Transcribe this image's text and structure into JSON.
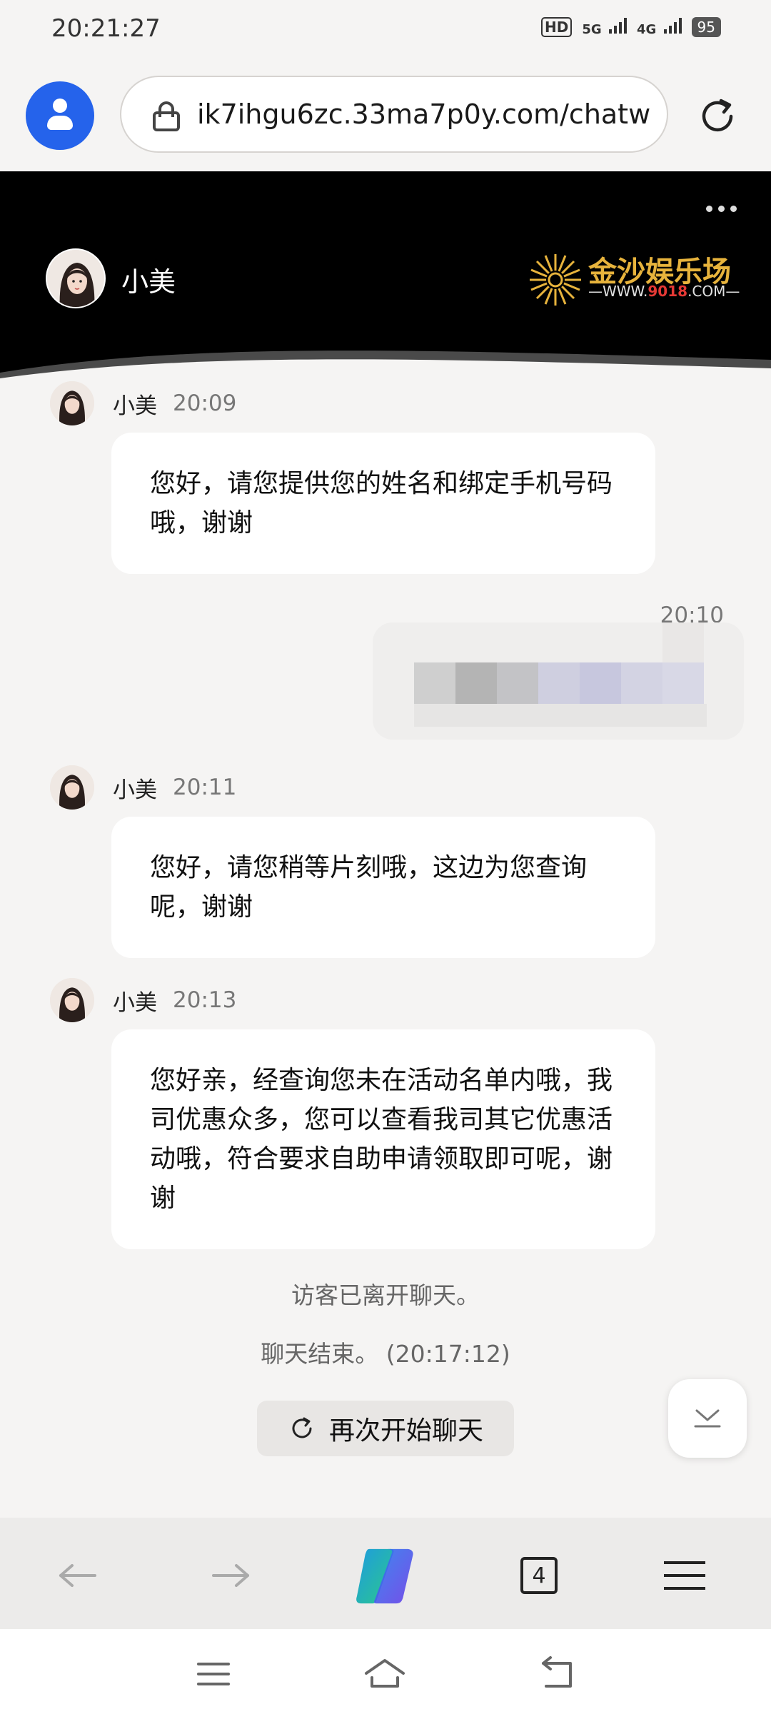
{
  "status_bar": {
    "time": "20:21:27",
    "hd": "HD",
    "net1": "5G",
    "net2": "4G",
    "battery": "95"
  },
  "browser": {
    "url": "ik7ihgu6zc.33ma7p0y.com/chatw",
    "tab_count": "4"
  },
  "chat_header": {
    "agent_name": "小美",
    "logo_title": "金沙娱乐场",
    "logo_sub_prefix": "—WWW.",
    "logo_sub_num": "9018",
    "logo_sub_suffix": ".COM—"
  },
  "messages": [
    {
      "sender": "小美",
      "time": "20:09",
      "text": "您好，请您提供您的姓名和绑定手机号码哦，谢谢"
    },
    {
      "sender": "visitor",
      "time": "20:10",
      "text": ""
    },
    {
      "sender": "小美",
      "time": "20:11",
      "text": "您好，请您稍等片刻哦，这边为您查询呢，谢谢"
    },
    {
      "sender": "小美",
      "time": "20:13",
      "text": "您好亲，经查询您未在活动名单内哦，我司优惠众多，您可以查看我司其它优惠活动哦，符合要求自助申请领取即可呢，谢谢"
    }
  ],
  "system": {
    "left_text": "访客已离开聊天。",
    "ended_text": "聊天结束。 (20:17:12)",
    "restart_label": "再次开始聊天"
  },
  "icons": {
    "back": "arrow-left-icon",
    "forward": "arrow-right-icon",
    "copilot": "copilot-icon",
    "menu": "hamburger-icon"
  },
  "colors": {
    "accent_blue": "#2563eb",
    "header_bg": "#000000",
    "logo_gold": "#e7b33c"
  }
}
